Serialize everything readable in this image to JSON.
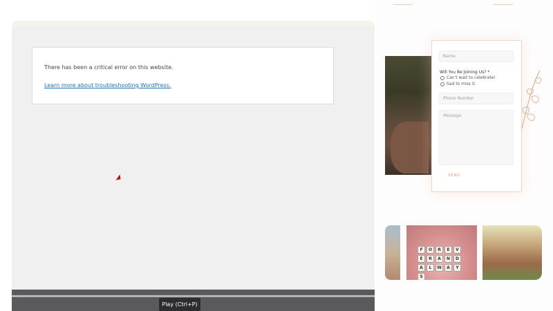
{
  "error_page": {
    "message": "There has been a critical error on this website.",
    "link_text": "Learn more about troubleshooting WordPress."
  },
  "player": {
    "tooltip": "Play (Ctrl+P)",
    "progress_percent": 0
  },
  "rsvp_form": {
    "name_placeholder": "Name",
    "question_label": "Will You Be Joining Us? *",
    "options": [
      "Can't wait to celebrate!",
      "Sad to miss it."
    ],
    "phone_placeholder": "Phone Number",
    "message_placeholder": "Message",
    "send_label": "SEND"
  },
  "gallery": {
    "tiles": [
      "F",
      "O",
      "R",
      "E",
      "V",
      "E",
      "R",
      "A",
      "N",
      "D",
      "A",
      "L",
      "W",
      "A",
      "Y",
      "S"
    ]
  },
  "colors": {
    "accent": "#d89570",
    "link": "#2271b1",
    "panel_bg": "#f1f0f1",
    "player_bar": "#5a595c"
  },
  "icons": {
    "cursor": "mouse-cursor-icon",
    "leaf": "leaf-branch-icon"
  }
}
